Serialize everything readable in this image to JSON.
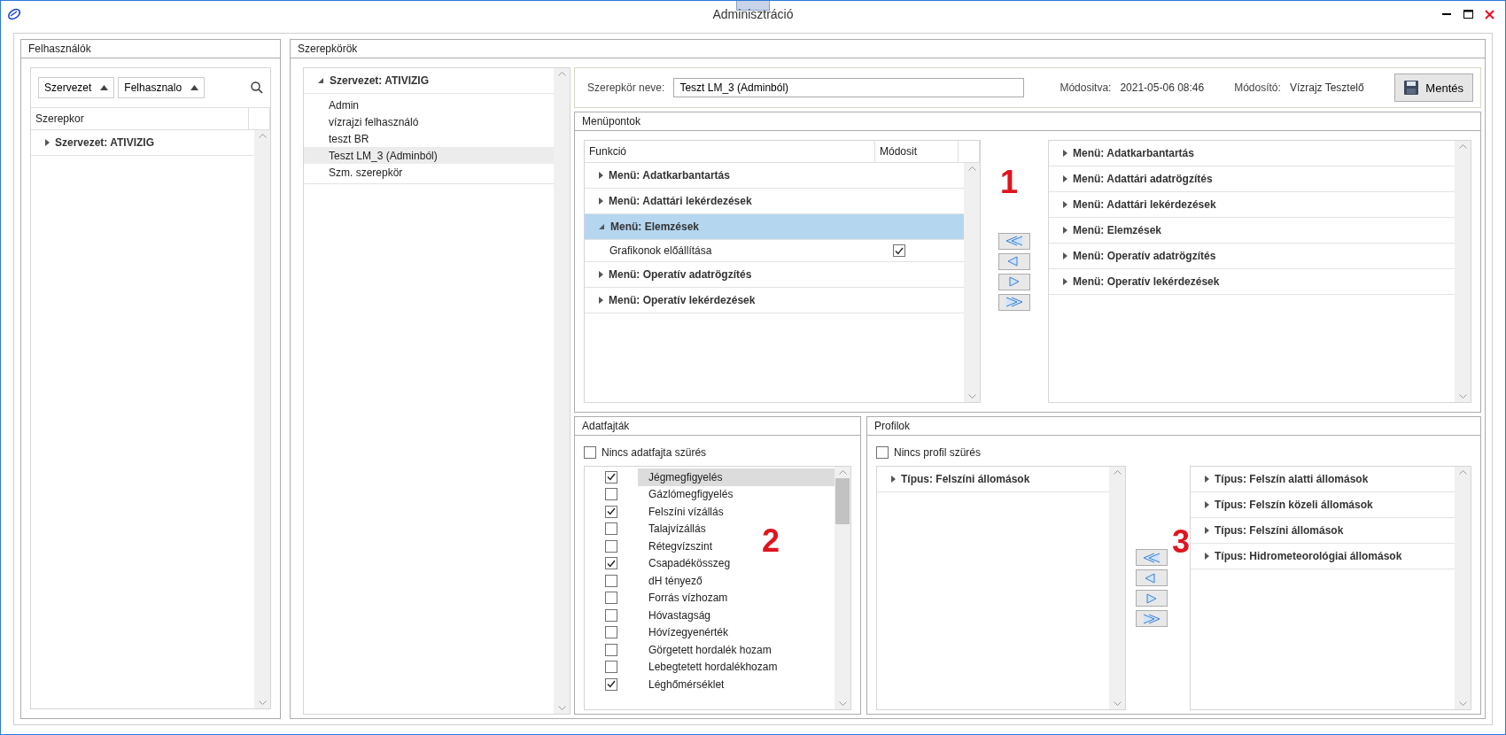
{
  "window": {
    "title": "Adminisztráció"
  },
  "users_panel": {
    "title": "Felhasználók",
    "filters": [
      "Szervezet",
      "Felhasznalo"
    ],
    "column": "Szerepkor",
    "tree": [
      {
        "label": "Szervezet: ATIVIZIG",
        "expanded": false
      }
    ]
  },
  "roles_panel": {
    "title": "Szerepkörök",
    "tree": [
      {
        "label": "Szervezet: ATIVIZIG",
        "expanded": true,
        "children": [
          {
            "label": "Admin",
            "selected": false
          },
          {
            "label": "vízrajzi felhasználó",
            "selected": false
          },
          {
            "label": "teszt BR",
            "selected": false
          },
          {
            "label": "Teszt LM_3 (Adminból)",
            "selected": true
          },
          {
            "label": "Szm. szerepkör",
            "selected": false
          }
        ]
      }
    ]
  },
  "role_header": {
    "name_label": "Szerepkör neve:",
    "name_value": "Teszt LM_3 (Adminból)",
    "modified_label": "Módositva:",
    "modified_value": "2021-05-06 08:46",
    "modifier_label": "Módosító:",
    "modifier_value": "Vízrajz Tesztelő",
    "save_button": "Mentés"
  },
  "menu_points": {
    "title": "Menüpontok",
    "columns": [
      "Funkció",
      "Módosit"
    ],
    "marker": "1",
    "rows": [
      {
        "label": "Menü: Adatkarbantartás",
        "expanded": false,
        "selected": false
      },
      {
        "label": "Menü: Adattári lekérdezések",
        "expanded": false,
        "selected": false
      },
      {
        "label": "Menü: Elemzések",
        "expanded": true,
        "selected": true,
        "children": [
          {
            "label": "Grafikonok előállítása",
            "checked": true
          }
        ]
      },
      {
        "label": "Menü: Operatív adatrögzítés",
        "expanded": false,
        "selected": false
      },
      {
        "label": "Menü: Operatív lekérdezések",
        "expanded": false,
        "selected": false
      }
    ],
    "available": [
      {
        "label": "Menü: Adatkarbantartás",
        "expanded": false
      },
      {
        "label": "Menü: Adattári adatrögzítés",
        "expanded": false
      },
      {
        "label": "Menü: Adattári lekérdezések",
        "expanded": false
      },
      {
        "label": "Menü: Elemzések",
        "expanded": false
      },
      {
        "label": "Menü: Operatív adatrögzítés",
        "expanded": false
      },
      {
        "label": "Menü: Operatív lekérdezések",
        "expanded": false
      }
    ]
  },
  "data_types": {
    "title": "Adatfajták",
    "marker": "2",
    "no_filter": {
      "label": "Nincs adatfajta szürés",
      "checked": false
    },
    "items": [
      {
        "label": "Jégmegfigyelés",
        "checked": true,
        "selected": true
      },
      {
        "label": "Gázlómegfigyelés",
        "checked": false,
        "selected": false
      },
      {
        "label": "Felszíni vízállás",
        "checked": true,
        "selected": false
      },
      {
        "label": "Talajvízállás",
        "checked": false,
        "selected": false
      },
      {
        "label": "Rétegvízszint",
        "checked": false,
        "selected": false
      },
      {
        "label": "Csapadékösszeg",
        "checked": true,
        "selected": false
      },
      {
        "label": "dH tényező",
        "checked": false,
        "selected": false
      },
      {
        "label": "Forrás vízhozam",
        "checked": false,
        "selected": false
      },
      {
        "label": "Hóvastagság",
        "checked": false,
        "selected": false
      },
      {
        "label": "Hóvízegyenérték",
        "checked": false,
        "selected": false
      },
      {
        "label": "Görgetett hordalék hozam",
        "checked": false,
        "selected": false
      },
      {
        "label": "Lebegtetett hordalékhozam",
        "checked": false,
        "selected": false
      },
      {
        "label": "Léghőmérséklet",
        "checked": true,
        "selected": false
      }
    ]
  },
  "profiles": {
    "title": "Profilok",
    "marker": "3",
    "no_filter": {
      "label": "Nincs profil szürés",
      "checked": false
    },
    "selected_types": [
      {
        "label": "Típus: Felszíni állomások",
        "expanded": false
      }
    ],
    "available": [
      {
        "label": "Típus: Felszín alatti állomások",
        "expanded": false
      },
      {
        "label": "Típus: Felszín közeli állomások",
        "expanded": false
      },
      {
        "label": "Típus: Felszíni állomások",
        "expanded": false
      },
      {
        "label": "Típus: Hidrometeorológiai állomások",
        "expanded": false
      }
    ]
  }
}
